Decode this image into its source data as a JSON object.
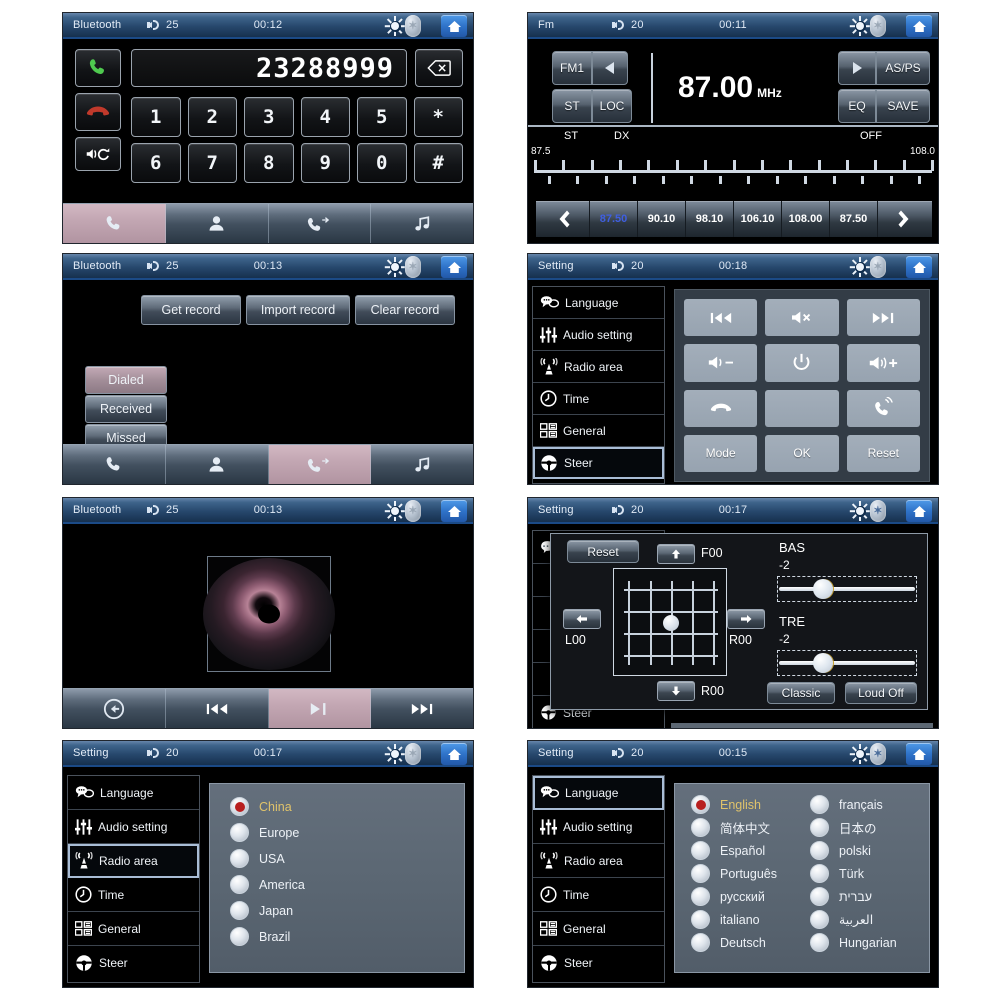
{
  "meta": {
    "accent_selected": "#c3a7b3",
    "accent_blue": "#3f5fe0",
    "radio_red": "#b81f1f"
  },
  "panels": {
    "phone_dialer": {
      "status": {
        "title": "Bluetooth",
        "volume": "25",
        "time": "00:12",
        "sun_icon": "brightness-icon",
        "bt_icon": "bluetooth-icon",
        "home_icon": "home-icon"
      },
      "number": "23288999",
      "call_icon": "call-answer-icon",
      "end_icon": "call-end-icon",
      "transfer_icon": "audio-transfer-icon",
      "backspace_icon": "backspace-icon",
      "keys_row1": [
        "1",
        "2",
        "3",
        "4",
        "5",
        "*"
      ],
      "keys_row2": [
        "6",
        "7",
        "8",
        "9",
        "0",
        "#"
      ],
      "tabs": [
        {
          "name": "tab-dialer",
          "icon": "phone-icon",
          "active": true
        },
        {
          "name": "tab-contacts",
          "icon": "contact-icon",
          "active": false
        },
        {
          "name": "tab-records",
          "icon": "call-log-icon",
          "active": false
        },
        {
          "name": "tab-music",
          "icon": "music-note-icon",
          "active": false
        }
      ]
    },
    "fm_radio": {
      "status": {
        "title": "Fm",
        "volume": "20",
        "time": "00:11"
      },
      "band_label": "FM1",
      "prev_icon": "play-left-icon",
      "next_icon": "play-right-icon",
      "st_label": "ST",
      "loc_label": "LOC",
      "as_ps_label": "AS/PS",
      "eq_label": "EQ",
      "save_label": "SAVE",
      "frequency": "87.00",
      "frequency_unit": "MHz",
      "indicator_st": "ST",
      "indicator_dx": "DX",
      "indicator_off": "OFF",
      "scale_min": "87.5",
      "scale_max": "108.0",
      "scale_major_ticks": 15,
      "scale_minor_ticks": 14,
      "prev_arrow": "chevron-left-icon",
      "next_arrow": "chevron-right-icon",
      "presets": [
        {
          "value": "87.50",
          "active": true
        },
        {
          "value": "90.10",
          "active": false
        },
        {
          "value": "98.10",
          "active": false
        },
        {
          "value": "106.10",
          "active": false
        },
        {
          "value": "108.00",
          "active": false
        },
        {
          "value": "87.50",
          "active": false
        }
      ]
    },
    "call_records": {
      "status": {
        "title": "Bluetooth",
        "volume": "25",
        "time": "00:13"
      },
      "actions": [
        "Get record",
        "Import record",
        "Clear record"
      ],
      "filters": [
        {
          "label": "Dialed",
          "active": true
        },
        {
          "label": "Received",
          "active": false
        },
        {
          "label": "Missed",
          "active": false
        }
      ],
      "tabs": [
        {
          "name": "tab-dialer",
          "icon": "phone-icon",
          "active": false
        },
        {
          "name": "tab-contacts",
          "icon": "contact-icon",
          "active": false
        },
        {
          "name": "tab-records",
          "icon": "call-log-icon",
          "active": true
        },
        {
          "name": "tab-music",
          "icon": "music-note-icon",
          "active": false
        }
      ]
    },
    "steer_setting": {
      "status": {
        "title": "Setting",
        "volume": "20",
        "time": "00:18"
      },
      "sidebar": [
        {
          "label": "Language",
          "icon": "speech-bubbles-icon",
          "active": false
        },
        {
          "label": "Audio setting",
          "icon": "sliders-icon",
          "active": false
        },
        {
          "label": "Radio area",
          "icon": "radio-tower-icon",
          "active": false
        },
        {
          "label": "Time",
          "icon": "clock-icon",
          "active": false
        },
        {
          "label": "General",
          "icon": "grid-icon",
          "active": false
        },
        {
          "label": "Steer",
          "icon": "steering-wheel-icon",
          "active": true
        }
      ],
      "buttons": [
        {
          "label": "",
          "icon": "previous-track-icon"
        },
        {
          "label": "",
          "icon": "mute-icon"
        },
        {
          "label": "",
          "icon": "next-track-icon"
        },
        {
          "label": "",
          "icon": "volume-down-icon"
        },
        {
          "label": "",
          "icon": "power-icon"
        },
        {
          "label": "",
          "icon": "volume-up-icon"
        },
        {
          "label": "",
          "icon": "call-end-icon"
        },
        {
          "label": "",
          "icon": "blank-icon"
        },
        {
          "label": "",
          "icon": "call-answer-icon"
        },
        {
          "label": "Mode",
          "icon": ""
        },
        {
          "label": "OK",
          "icon": ""
        },
        {
          "label": "Reset",
          "icon": ""
        }
      ]
    },
    "media_player": {
      "status": {
        "title": "Bluetooth",
        "volume": "25",
        "time": "00:13"
      },
      "disc_icon": "disc-art-icon",
      "controls": [
        {
          "name": "back-button",
          "icon": "back-circle-icon",
          "active": false
        },
        {
          "name": "previous-button",
          "icon": "previous-track-icon",
          "active": false
        },
        {
          "name": "play-pause-button",
          "icon": "play-pause-icon",
          "active": true
        },
        {
          "name": "next-button",
          "icon": "next-track-icon",
          "active": false
        }
      ]
    },
    "audio_setting": {
      "status": {
        "title": "Setting",
        "volume": "20",
        "time": "00:17"
      },
      "reset_label": "Reset",
      "front_label": "F00",
      "rear_label": "R00",
      "left_label": "L00",
      "right_label": "R00",
      "up_icon": "arrow-up-icon",
      "down_icon": "arrow-down-icon",
      "left_icon": "arrow-left-icon",
      "right_icon": "arrow-right-icon",
      "bass_label": "BAS",
      "bass_value": "-2",
      "treble_label": "TRE",
      "treble_value": "-2",
      "eq_preset_label": "Classic",
      "loudness_label": "Loud Off",
      "sidebar_tail": {
        "label": "Steer",
        "icon": "steering-wheel-icon"
      }
    },
    "radio_area": {
      "status": {
        "title": "Setting",
        "volume": "20",
        "time": "00:17"
      },
      "sidebar": [
        {
          "label": "Language",
          "icon": "speech-bubbles-icon",
          "active": false
        },
        {
          "label": "Audio setting",
          "icon": "sliders-icon",
          "active": false
        },
        {
          "label": "Radio area",
          "icon": "radio-tower-icon",
          "active": true
        },
        {
          "label": "Time",
          "icon": "clock-icon",
          "active": false
        },
        {
          "label": "General",
          "icon": "grid-icon",
          "active": false
        },
        {
          "label": "Steer",
          "icon": "steering-wheel-icon",
          "active": false
        }
      ],
      "options": [
        {
          "label": "China",
          "selected": true
        },
        {
          "label": "Europe",
          "selected": false
        },
        {
          "label": "USA",
          "selected": false
        },
        {
          "label": "America",
          "selected": false
        },
        {
          "label": "Japan",
          "selected": false
        },
        {
          "label": "Brazil",
          "selected": false
        }
      ]
    },
    "language": {
      "status": {
        "title": "Setting",
        "volume": "20",
        "time": "00:15"
      },
      "sidebar": [
        {
          "label": "Language",
          "icon": "speech-bubbles-icon",
          "active": true
        },
        {
          "label": "Audio setting",
          "icon": "sliders-icon",
          "active": false
        },
        {
          "label": "Radio area",
          "icon": "radio-tower-icon",
          "active": false
        },
        {
          "label": "Time",
          "icon": "clock-icon",
          "active": false
        },
        {
          "label": "General",
          "icon": "grid-icon",
          "active": false
        },
        {
          "label": "Steer",
          "icon": "steering-wheel-icon",
          "active": false
        }
      ],
      "column_left": [
        {
          "label": "English",
          "selected": true
        },
        {
          "label": "简体中文",
          "selected": false
        },
        {
          "label": "Español",
          "selected": false
        },
        {
          "label": "Português",
          "selected": false
        },
        {
          "label": "русский",
          "selected": false
        },
        {
          "label": "italiano",
          "selected": false
        },
        {
          "label": "Deutsch",
          "selected": false
        }
      ],
      "column_right": [
        {
          "label": "français",
          "selected": false
        },
        {
          "label": "日本の",
          "selected": false
        },
        {
          "label": "polski",
          "selected": false
        },
        {
          "label": "Türk",
          "selected": false
        },
        {
          "label": "עברית",
          "selected": false
        },
        {
          "label": "العربية",
          "selected": false
        },
        {
          "label": "Hungarian",
          "selected": false
        }
      ]
    }
  }
}
